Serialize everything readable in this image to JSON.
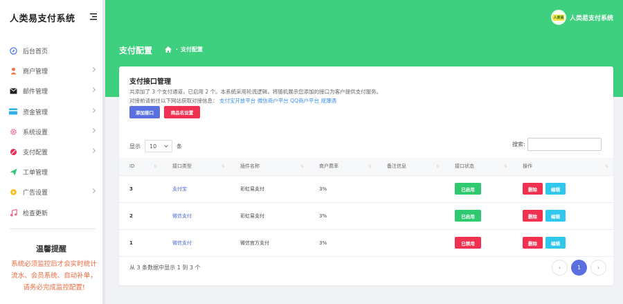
{
  "app": {
    "title": "人类易支付系统"
  },
  "colors": {
    "primary": "#3ed07e",
    "accent": "#5a6fe0",
    "danger": "#f0314f",
    "info": "#30c7ec",
    "warning_text": "#ef6a3e"
  },
  "sidebar": {
    "items": [
      {
        "label": "后台首页",
        "icon": "compass-icon",
        "arrow": false
      },
      {
        "label": "商户管理",
        "icon": "user-icon",
        "arrow": true
      },
      {
        "label": "邮件管理",
        "icon": "mail-icon",
        "arrow": true
      },
      {
        "label": "资金管理",
        "icon": "wallet-icon",
        "arrow": true
      },
      {
        "label": "系统设置",
        "icon": "gear-icon",
        "arrow": true
      },
      {
        "label": "支付配置",
        "icon": "pay-icon",
        "arrow": true
      },
      {
        "label": "工单管理",
        "icon": "send-icon",
        "arrow": false
      },
      {
        "label": "广告设置",
        "icon": "sun-icon",
        "arrow": true
      },
      {
        "label": "检查更新",
        "icon": "music-icon",
        "arrow": false
      }
    ],
    "tip": {
      "title": "温馨提醒",
      "text": "系统必须监控后才会实时统计流水、会员系统、自动补单，请务必完成监控配置!"
    }
  },
  "header": {
    "user_name": "人类易支付系统",
    "page_title": "支付配置",
    "breadcrumb": "支付配置"
  },
  "card": {
    "title": "支付接口管理",
    "desc": "共添加了 3 个支付通道，已启用 2 个。本系统采用轮流逻辑，将随机展示您添加的接口为客户提供支付服务。",
    "desc2_prefix": "对接前请前往以下网站获取对接信息：",
    "links": [
      "支付宝开放平台",
      "微信商户平台",
      "QQ商户平台",
      "规薄酒"
    ],
    "btn_add": "添加接口",
    "btn_goods": "商品名设置",
    "show_label": "显示",
    "show_value": "10",
    "show_unit": "条",
    "search_label": "搜索:",
    "search_placeholder": "",
    "columns": [
      "ID",
      "接口类型",
      "插件名称",
      "商户费率",
      "备注信息",
      "接口状态",
      "操作"
    ],
    "rows": [
      {
        "id": "3",
        "type": "支付宝",
        "plugin": "彩虹易支付",
        "rate": "3%",
        "note": "",
        "status": "已启用",
        "status_on": true
      },
      {
        "id": "2",
        "type": "微信支付",
        "plugin": "彩虹易支付",
        "rate": "3%",
        "note": "",
        "status": "已启用",
        "status_on": true
      },
      {
        "id": "1",
        "type": "微信支付",
        "plugin": "微信官方支付",
        "rate": "3%",
        "note": "",
        "status": "已禁用",
        "status_on": false
      }
    ],
    "btn_delete": "删除",
    "btn_edit": "编辑",
    "info": "从 3 条数据中显示 1 到 3 个",
    "page_current": "1",
    "page_prev": "‹",
    "page_next": "›"
  }
}
